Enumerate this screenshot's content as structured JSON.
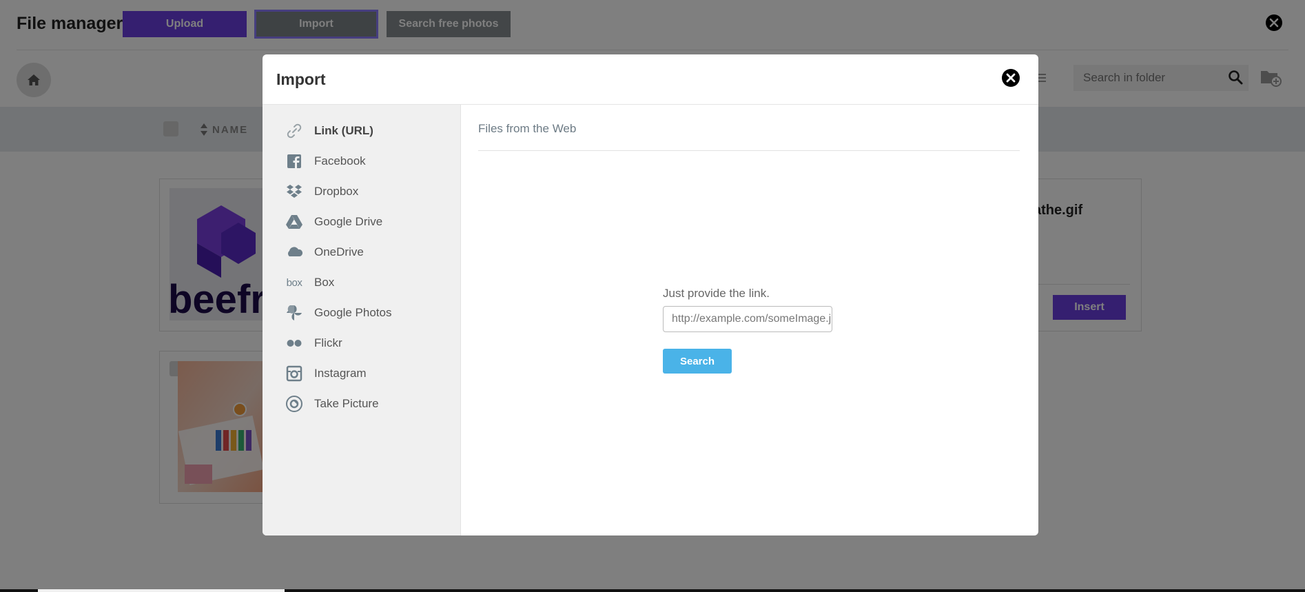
{
  "file_manager": {
    "title": "File manager",
    "upload_label": "Upload",
    "import_label": "Import",
    "free_photos_label": "Search free photos",
    "search_placeholder": "Search in folder",
    "column_name": "NAME",
    "file_name": "athe.gif",
    "insert_label": "Insert",
    "thumbnail_text": "beefre"
  },
  "modal": {
    "title": "Import",
    "sources": [
      {
        "label": "Link (URL)",
        "icon": "link-icon",
        "active": true
      },
      {
        "label": "Facebook",
        "icon": "facebook-icon",
        "active": false
      },
      {
        "label": "Dropbox",
        "icon": "dropbox-icon",
        "active": false
      },
      {
        "label": "Google Drive",
        "icon": "google-drive-icon",
        "active": false
      },
      {
        "label": "OneDrive",
        "icon": "onedrive-icon",
        "active": false
      },
      {
        "label": "Box",
        "icon": "box-icon",
        "active": false
      },
      {
        "label": "Google Photos",
        "icon": "google-photos-icon",
        "active": false
      },
      {
        "label": "Flickr",
        "icon": "flickr-icon",
        "active": false
      },
      {
        "label": "Instagram",
        "icon": "instagram-icon",
        "active": false
      },
      {
        "label": "Take Picture",
        "icon": "camera-icon",
        "active": false
      }
    ],
    "main": {
      "heading": "Files from the Web",
      "link_label": "Just provide the link.",
      "link_placeholder": "http://example.com/someImage.jpg",
      "search_label": "Search"
    },
    "box_logo_text": "box"
  },
  "colors": {
    "brand_purple": "#6b3fe0",
    "search_blue": "#4ab3e8",
    "overlay": "rgba(0,0,0,0.5)"
  }
}
